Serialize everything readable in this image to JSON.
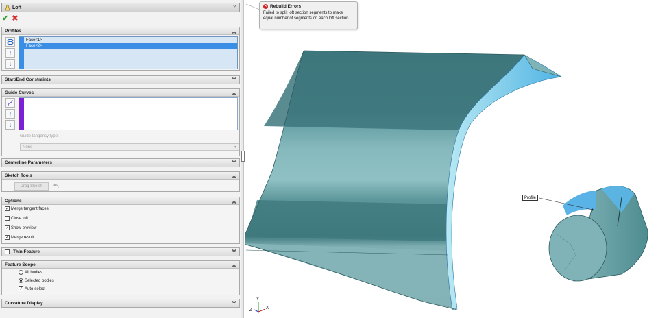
{
  "panel": {
    "title": "Loft",
    "help": "?",
    "ok_glyph": "✔",
    "cancel_glyph": "✖"
  },
  "profiles": {
    "header": "Profiles",
    "items": [
      "Face<1>",
      "Face<2>"
    ],
    "selected_index": 1
  },
  "start_end": {
    "header": "Start/End Constraints"
  },
  "guide_curves": {
    "header": "Guide Curves",
    "tangency_label": "Guide tangency type:",
    "tangency_value": "None"
  },
  "centerline": {
    "header": "Centerline Parameters"
  },
  "sketch_tools": {
    "header": "Sketch Tools",
    "drag_sketch": "Drag Sketch"
  },
  "options": {
    "header": "Options",
    "items": [
      {
        "label": "Merge tangent faces",
        "checked": true
      },
      {
        "label": "Close loft",
        "checked": false
      },
      {
        "label": "Show preview",
        "checked": true
      },
      {
        "label": "Merge result",
        "checked": true
      }
    ]
  },
  "thin_feature": {
    "header": "Thin Feature",
    "checked": false
  },
  "feature_scope": {
    "header": "Feature Scope",
    "all_bodies": "All bodies",
    "selected_bodies": "Selected bodies",
    "selected": "selected_bodies",
    "auto_select": "Auto-select",
    "auto_select_checked": true
  },
  "curvature": {
    "header": "Curvature Display"
  },
  "tooltip": {
    "title": "Rebuild Errors",
    "body": "Failed to split loft section segments to make equal number of segments on each loft section."
  },
  "viewport": {
    "callout": "Profile",
    "triad": {
      "y": "Y",
      "x": "X",
      "z": "Z"
    }
  },
  "colors": {
    "profile_blue": "#3a8ee6",
    "guide_purple": "#7b22d6",
    "model_teal": "#6fa7ad",
    "error_red": "#d32424"
  }
}
